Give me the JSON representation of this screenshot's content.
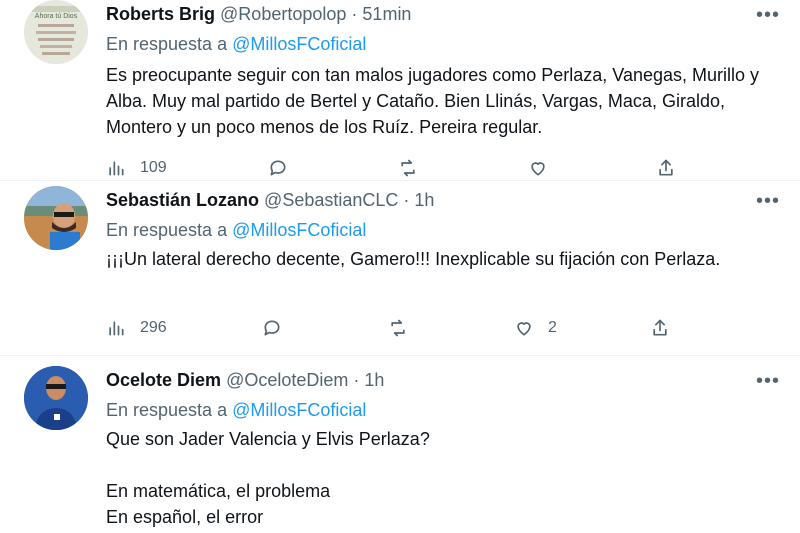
{
  "tweets": [
    {
      "name": "Roberts Brig",
      "handle": "@Robertopolop",
      "dot": "·",
      "time": "51min",
      "reply_prefix": "En respuesta a",
      "reply_mention": "@MillosFCoficial",
      "text": "Es preocupante seguir con tan malos jugadores como Perlaza, Vanegas, Murillo y Alba. Muy mal partido de Bertel y Cataño. Bien Llinás, Vargas, Maca, Giraldo, Montero y un poco menos de los Ruíz. Pereira regular.",
      "views": "109",
      "replies": "",
      "retweets": "",
      "likes": "",
      "more": "•••"
    },
    {
      "name": "Sebastián Lozano",
      "handle": "@SebastianCLC",
      "dot": "·",
      "time": "1h",
      "reply_prefix": "En respuesta a",
      "reply_mention": "@MillosFCoficial",
      "text": "¡¡¡Un lateral derecho decente, Gamero!!! Inexplicable su fijación con Perlaza.",
      "views": "296",
      "replies": "",
      "retweets": "",
      "likes": "2",
      "more": "•••"
    },
    {
      "name": "Ocelote Diem",
      "handle": "@OceloteDiem",
      "dot": "·",
      "time": "1h",
      "reply_prefix": "En respuesta a",
      "reply_mention": "@MillosFCoficial",
      "text": "Que son Jader Valencia y Elvis Perlaza?\n\nEn matemática, el problema\nEn español, el error",
      "more": "•••"
    }
  ],
  "avatar1_text": "Ahora tú Dios"
}
